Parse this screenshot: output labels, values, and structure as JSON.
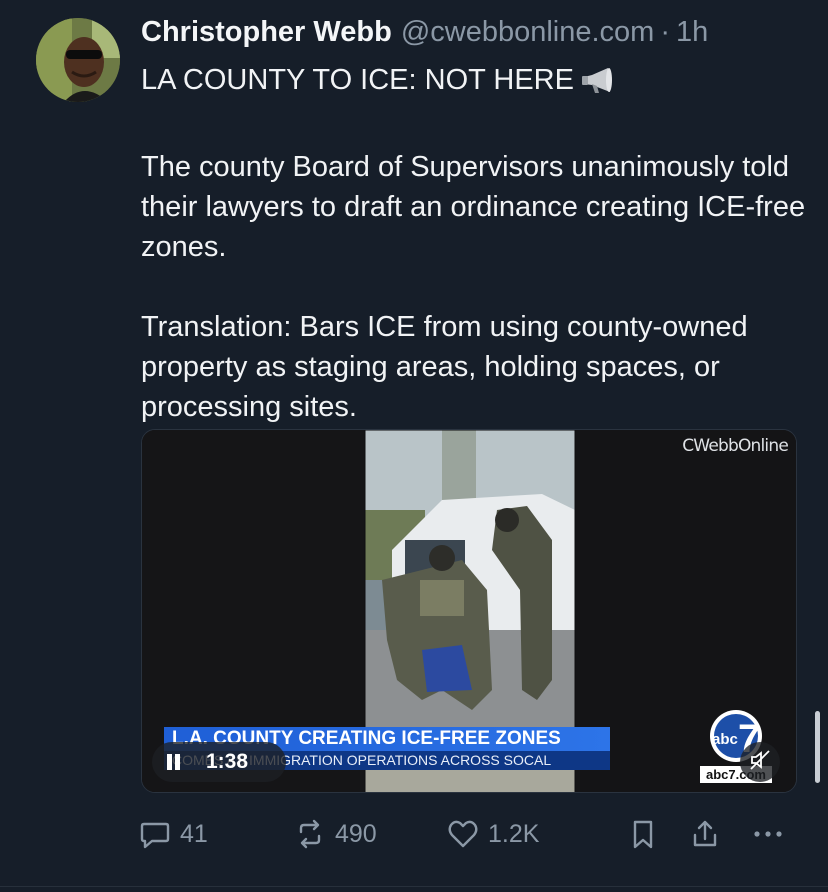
{
  "author": {
    "display_name": "Christopher Webb",
    "handle": "@cwebbonline.com",
    "separator": "·",
    "time_ago": "1h"
  },
  "post": {
    "headline": "LA COUNTY TO ICE: NOT HERE",
    "paragraph_1": "The county Board of Supervisors unanimously told their lawyers to draft an ordinance creating ICE-free zones.",
    "paragraph_2": "Translation: Bars ICE from using county-owned property as staging areas, holding spaces, or processing sites."
  },
  "video": {
    "watermark": "CWebbOnline",
    "chyron_title": "L.A. COUNTY CREATING ICE-FREE ZONES",
    "chyron_subtitle": "COMES AS IMMIGRATION OPERATIONS ACROSS SOCAL",
    "duration": "1:38",
    "station_logo_text": "abc",
    "station_logo_number": "7",
    "station_url": "abc7.com",
    "state": "playing",
    "muted": true
  },
  "actions": {
    "reply_count": "41",
    "repost_count": "490",
    "like_count": "1.2K"
  },
  "icons": {
    "headline_emoji": "megaphone-icon",
    "reply": "speech-bubble-icon",
    "repost": "repost-arrows-icon",
    "like": "heart-icon",
    "bookmark": "bookmark-icon",
    "share": "share-icon",
    "more": "ellipsis-icon",
    "pause": "pause-icon",
    "mute": "muted-speaker-icon"
  },
  "colors": {
    "background": "#161e29",
    "text_primary": "#f1f3f5",
    "text_secondary": "#8b98a6",
    "chyron_blue": "#1f5fd6",
    "chyron_dark_blue": "#0e3786"
  }
}
